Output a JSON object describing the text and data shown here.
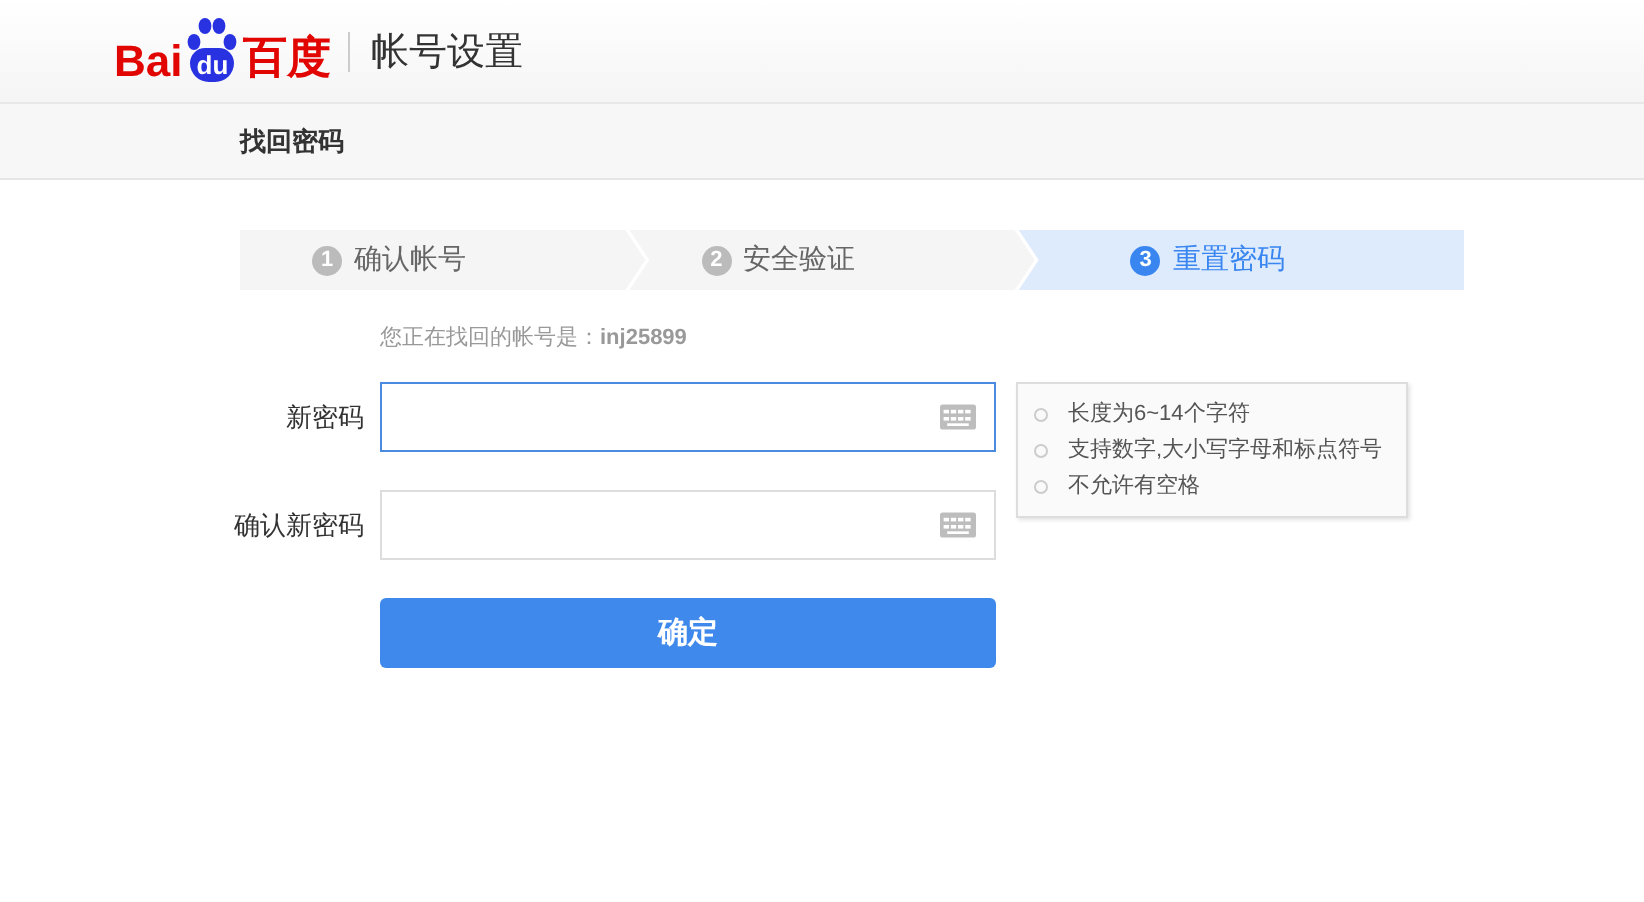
{
  "header": {
    "logo": {
      "left": "Bai",
      "paw": "du",
      "right": "百度"
    },
    "title": "帐号设置"
  },
  "subnav": {
    "title": "找回密码"
  },
  "steps": [
    {
      "number": "1",
      "label": "确认帐号",
      "selected": false
    },
    {
      "number": "2",
      "label": "安全验证",
      "selected": false
    },
    {
      "number": "3",
      "label": "重置密码",
      "selected": true
    }
  ],
  "account": {
    "label": "您正在找回的帐号是：",
    "value": "inj25899"
  },
  "fields": [
    {
      "label": "新密码",
      "focused": true
    },
    {
      "label": "确认新密码",
      "focused": false
    }
  ],
  "tooltip": {
    "rules": [
      "长度为6~14个字符",
      "支持数字,大小写字母和标点符号",
      "不允许有空格"
    ]
  },
  "submit": "确定"
}
